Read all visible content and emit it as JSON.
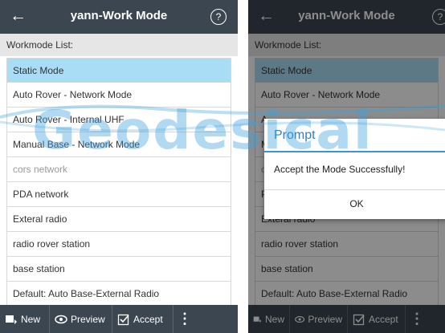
{
  "left": {
    "header": {
      "title": "yann-Work Mode",
      "back_glyph": "←",
      "help_glyph": "?"
    },
    "list_title": "Workmode List:",
    "items": [
      "Static Mode",
      "Auto Rover - Network Mode",
      "Auto Rover - Internal UHF",
      "Manual Base - Network Mode",
      "cors network",
      "PDA network",
      "Exteral radio",
      "radio rover station",
      "base station",
      "Default: Auto Base-External Radio"
    ],
    "toolbar": {
      "new": "New",
      "preview": "Preview",
      "accept": "Accept",
      "more": "⋮"
    }
  },
  "right": {
    "header": {
      "title": "yann-Work Mode",
      "back_glyph": "←",
      "help_glyph": "?"
    },
    "list_title": "Workmode List:",
    "items": [
      "Static Mode",
      "Auto Rover - Network Mode",
      "A",
      "M",
      "c",
      "P",
      "Exteral radio",
      "radio rover station",
      "base station",
      "Default: Auto Base-External Radio"
    ],
    "toolbar": {
      "new": "New",
      "preview": "Preview",
      "accept": "Accept",
      "more": "⋮"
    },
    "dialog": {
      "title": "Prompt",
      "message": "Accept the Mode Successfully!",
      "ok": "OK"
    }
  },
  "watermark": "Geodesical",
  "colors": {
    "header": "#3b4650",
    "selected": "#a9dcf5",
    "dialog_accent": "#3a94d6"
  },
  "icons": [
    "back-arrow",
    "help-circle",
    "new-icon",
    "preview-eye",
    "accept-check",
    "more-vert"
  ]
}
